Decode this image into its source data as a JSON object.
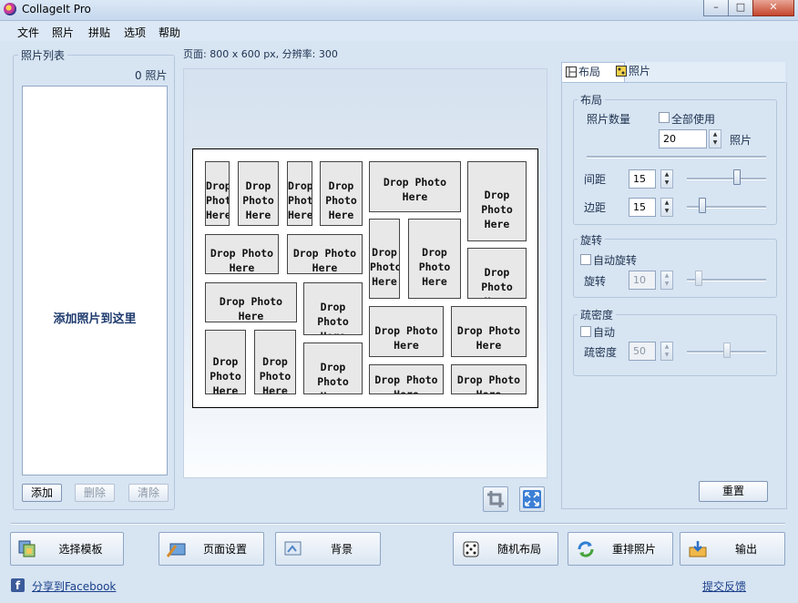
{
  "window": {
    "title": "CollageIt Pro",
    "minimize": "–",
    "maximize": "□",
    "close": "✕"
  },
  "menu": [
    "文件",
    "照片",
    "拼贴",
    "选项",
    "帮助"
  ],
  "photo_list": {
    "title": "照片列表",
    "count": "0 照片",
    "hint": "添加照片到这里",
    "add": "添加",
    "delete": "删除",
    "clear": "清除"
  },
  "page_info": "页面: 800 x 600 px, 分辨率: 300",
  "collage": {
    "cells": [
      {
        "text": "Drop Photo Here"
      },
      {
        "text": "Drop Photo Here"
      },
      {
        "text": "Drop Photo Here"
      },
      {
        "text": "Drop Photo Here"
      },
      {
        "text": "Drop Photo Here"
      },
      {
        "text": "Drop Photo Here"
      },
      {
        "text": "Drop Photo Here"
      },
      {
        "text": "Drop Photo Here"
      },
      {
        "text": "Drop Photo Here"
      },
      {
        "text": "Drop Photo Here"
      },
      {
        "text": "Drop Photo Here"
      },
      {
        "text": "Drop Photo Here"
      },
      {
        "text": "Drop Photo Here"
      },
      {
        "text": "Drop Photo Here"
      },
      {
        "text": "Drop Photo Here"
      },
      {
        "text": "Drop Photo Here"
      },
      {
        "text": "Drop Photo Here"
      },
      {
        "text": "Drop Photo Here"
      },
      {
        "text": "Drop Photo Here"
      },
      {
        "text": "Drop Photo Here"
      }
    ]
  },
  "tabs": {
    "layout": "布局",
    "photo": "照片"
  },
  "layout_group": {
    "title": "布局",
    "photo_count_label": "照片数量",
    "use_all": "全部使用",
    "photo_count": "20",
    "photo_unit": "照片",
    "spacing_label": "间距",
    "spacing": "15",
    "margin_label": "边距",
    "margin": "15"
  },
  "rotation_group": {
    "title": "旋转",
    "auto_rotate": "自动旋转",
    "rotate_label": "旋转",
    "rotate": "10"
  },
  "density_group": {
    "title": "疏密度",
    "auto": "自动",
    "density_label": "疏密度",
    "density": "50"
  },
  "reset": "重置",
  "toolbar": {
    "select_template": "选择模板",
    "page_setup": "页面设置",
    "background": "背景",
    "random_layout": "随机布局",
    "shuffle_photos": "重排照片",
    "export": "输出"
  },
  "footer": {
    "share": "分享到Facebook",
    "feedback": "提交反馈"
  }
}
